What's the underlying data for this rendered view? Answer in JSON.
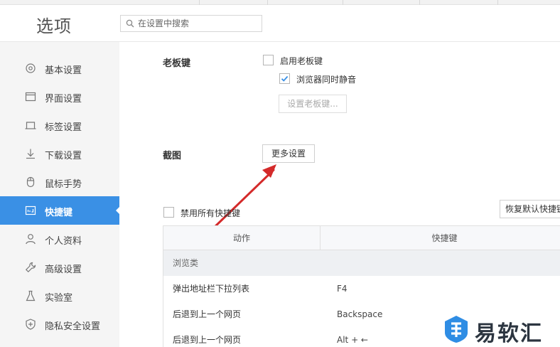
{
  "window": {
    "title": "选项"
  },
  "search": {
    "placeholder": "在设置中搜索"
  },
  "sidebar": {
    "items": [
      {
        "label": "基本设置",
        "icon": "gear-icon"
      },
      {
        "label": "界面设置",
        "icon": "window-icon"
      },
      {
        "label": "标签设置",
        "icon": "tab-icon"
      },
      {
        "label": "下载设置",
        "icon": "download-icon"
      },
      {
        "label": "鼠标手势",
        "icon": "mouse-icon"
      },
      {
        "label": "快捷键",
        "icon": "keyboard-icon",
        "active": true
      },
      {
        "label": "个人资料",
        "icon": "user-icon"
      },
      {
        "label": "高级设置",
        "icon": "wrench-icon"
      },
      {
        "label": "实验室",
        "icon": "flask-icon"
      },
      {
        "label": "隐私安全设置",
        "icon": "shield-icon"
      }
    ]
  },
  "boss_key": {
    "section_label": "老板键",
    "enable_label": "启用老板键",
    "enable_checked": false,
    "mute_label": "浏览器同时静音",
    "mute_checked": true,
    "set_button": "设置老板键..."
  },
  "screenshot": {
    "section_label": "截图",
    "more_button": "更多设置"
  },
  "shortcuts": {
    "disable_all_label": "禁用所有快捷键",
    "disable_all_checked": false,
    "restore_button": "恢复默认快捷键",
    "columns": [
      "动作",
      "快捷键"
    ],
    "group": "浏览类",
    "rows": [
      {
        "action": "弹出地址栏下拉列表",
        "key": "F4"
      },
      {
        "action": "后退到上一个网页",
        "key": "Backspace"
      },
      {
        "action": "后退到上一个网页",
        "key": "Alt + ←"
      }
    ]
  },
  "watermark": {
    "text": "易软汇"
  },
  "colors": {
    "accent": "#3a90e5",
    "arrow": "#d42a2a",
    "checkmark": "#3a90e5"
  }
}
